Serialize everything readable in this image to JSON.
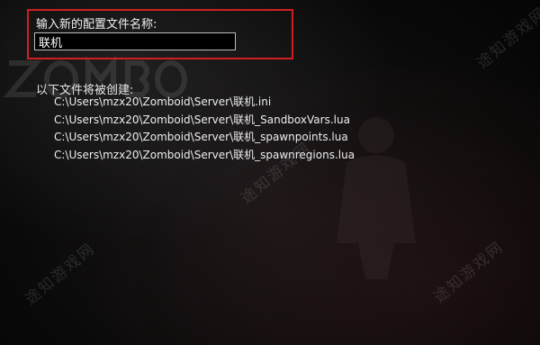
{
  "dialog": {
    "prompt_label": "输入新的配置文件名称:",
    "name_value": "联机"
  },
  "files": {
    "heading": "以下文件将被创建:",
    "paths": [
      "C:\\Users\\mzx20\\Zomboid\\Server\\联机.ini",
      "C:\\Users\\mzx20\\Zomboid\\Server\\联机_SandboxVars.lua",
      "C:\\Users\\mzx20\\Zomboid\\Server\\联机_spawnpoints.lua",
      "C:\\Users\\mzx20\\Zomboid\\Server\\联机_spawnregions.lua"
    ]
  },
  "watermark": {
    "text": "途知游戏网"
  },
  "colors": {
    "highlight_border": "#d11f1f",
    "text": "#e8e8e8",
    "background": "#0a0909"
  }
}
